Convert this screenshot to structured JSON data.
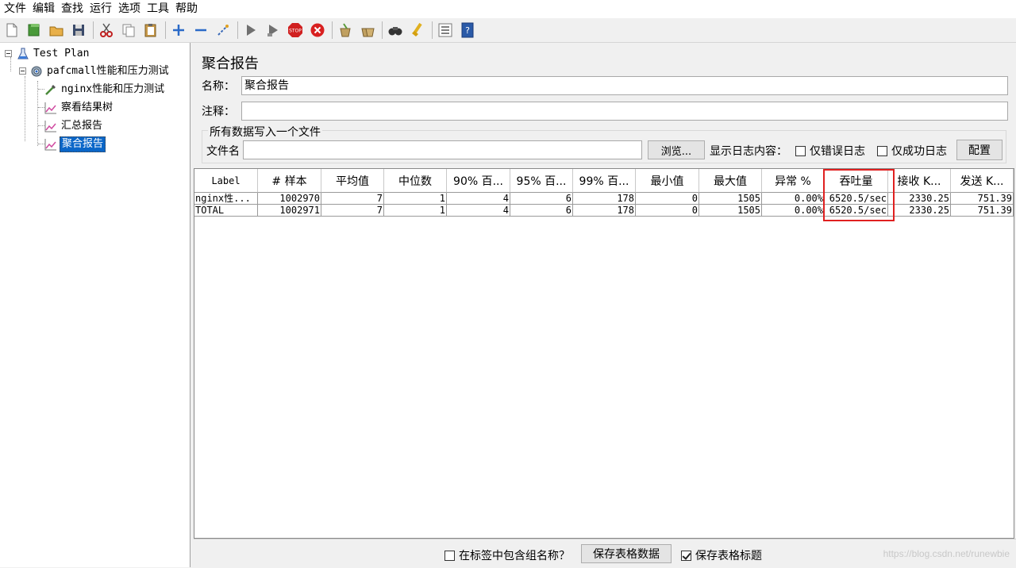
{
  "menu": [
    "文件",
    "编辑",
    "查找",
    "运行",
    "选项",
    "工具",
    "帮助"
  ],
  "toolbar_icons": [
    "new-icon",
    "templates-icon",
    "open-icon",
    "save-icon",
    "cut-icon",
    "copy-icon",
    "paste-icon",
    "add-icon",
    "remove-icon",
    "toggle-icon",
    "start-icon",
    "start-no-pause-icon",
    "stop-icon",
    "shutdown-icon",
    "clear-icon",
    "clear-all-icon",
    "search-icon",
    "reset-search-icon",
    "function-helper-icon",
    "help-icon"
  ],
  "tree": {
    "root": "Test Plan",
    "group": "pafcmall性能和压力测试",
    "sampler": "nginx性能和压力测试",
    "listeners": [
      "察看结果树",
      "汇总报告",
      "聚合报告"
    ]
  },
  "panel": {
    "title": "聚合报告",
    "name_label": "名称：",
    "name_value": "聚合报告",
    "comment_label": "注释：",
    "comment_value": "",
    "file_group_label": "所有数据写入一个文件",
    "filename_label": "文件名",
    "filename_value": "",
    "browse_button": "浏览...",
    "log_content_label": "显示日志内容：",
    "errors_only": "仅错误日志",
    "success_only": "仅成功日志",
    "configure_button": "配置"
  },
  "table": {
    "columns": [
      "Label",
      "# 样本",
      "平均值",
      "中位数",
      "90% 百...",
      "95% 百...",
      "99% 百...",
      "最小值",
      "最大值",
      "异常 %",
      "吞吐量",
      "接收 K...",
      "发送 K..."
    ],
    "rows": [
      [
        "nginx性...",
        "1002970",
        "7",
        "1",
        "4",
        "6",
        "178",
        "0",
        "1505",
        "0.00%",
        "6520.5/sec",
        "2330.25",
        "751.39"
      ],
      [
        "TOTAL",
        "1002971",
        "7",
        "1",
        "4",
        "6",
        "178",
        "0",
        "1505",
        "0.00%",
        "6520.5/sec",
        "2330.25",
        "751.39"
      ]
    ]
  },
  "bottom": {
    "include_group": "在标签中包含组名称？",
    "save_data_button": "保存表格数据",
    "save_header": "保存表格标题"
  },
  "watermark": "https://blog.csdn.net/runewbie",
  "colors": {
    "selection": "#0a66c8",
    "highlight_box": "#e02020"
  }
}
